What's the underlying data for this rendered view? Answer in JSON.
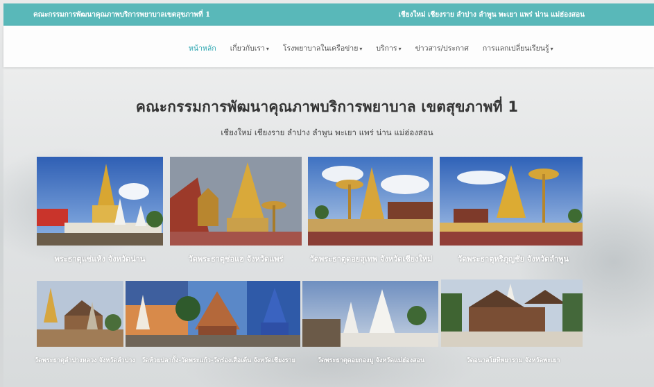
{
  "topbar": {
    "left_text": "คณะกรรมการพัฒนาคุณภาพบริการพยาบาลเขตสุขภาพที่ 1",
    "right_text": "เชียงใหม่ เชียงราย ลำปาง ลำพูน พะเยา แพร่ น่าน แม่ฮ่องสอน"
  },
  "nav": {
    "items": [
      {
        "label": "หน้าหลัก",
        "active": true,
        "dropdown": false
      },
      {
        "label": "เกี่ยวกับเรา",
        "active": false,
        "dropdown": true
      },
      {
        "label": "โรงพยาบาลในเครือข่าย",
        "active": false,
        "dropdown": true
      },
      {
        "label": "บริการ",
        "active": false,
        "dropdown": true
      },
      {
        "label": "ข่าวสาร/ประกาศ",
        "active": false,
        "dropdown": false
      },
      {
        "label": "การแลกเปลี่ยนเรียนรู้",
        "active": false,
        "dropdown": true
      }
    ]
  },
  "hero": {
    "title": "คณะกรรมการพัฒนาคุณภาพบริการพยาบาล เขตสุขภาพที่ 1",
    "subtitle": "เชียงใหม่ เชียงราย ลำปาง ลำพูน พะเยา แพร่ น่าน แม่ฮ่องสอน"
  },
  "gallery_row1": [
    {
      "caption": "พระธาตุแช่แห้ง จังหวัดน่าน"
    },
    {
      "caption": "วัดพระธาตุช่อแฮ จังหวัดแพร่"
    },
    {
      "caption": "วัดพระธาตุดอยสุเทพ จังหวัดเชียงใหม่"
    },
    {
      "caption": "วัดพระธาตุหริภุญชัย จังหวัดลำพูน"
    }
  ],
  "gallery_row2": [
    {
      "caption": "วัดพระธาตุลำปางหลวง จังหวัดลำปาง"
    },
    {
      "caption": "วัดห้วยปลากั้ง-วัดพระแก้ว-วัดร่องเสือเต้น จังหวัดเชียงราย"
    },
    {
      "caption": "วัดพระธาตุดอยกองมู จังหวัดแม่ฮ่องสอน"
    },
    {
      "caption": "วัดอนาลโยทิพยาราม จังหวัดพะเยา"
    }
  ],
  "colors": {
    "topbar": "#59b8b9",
    "nav_active": "#2aa5b0",
    "gold": "#d8a632",
    "sky": "#4a7fc4"
  }
}
